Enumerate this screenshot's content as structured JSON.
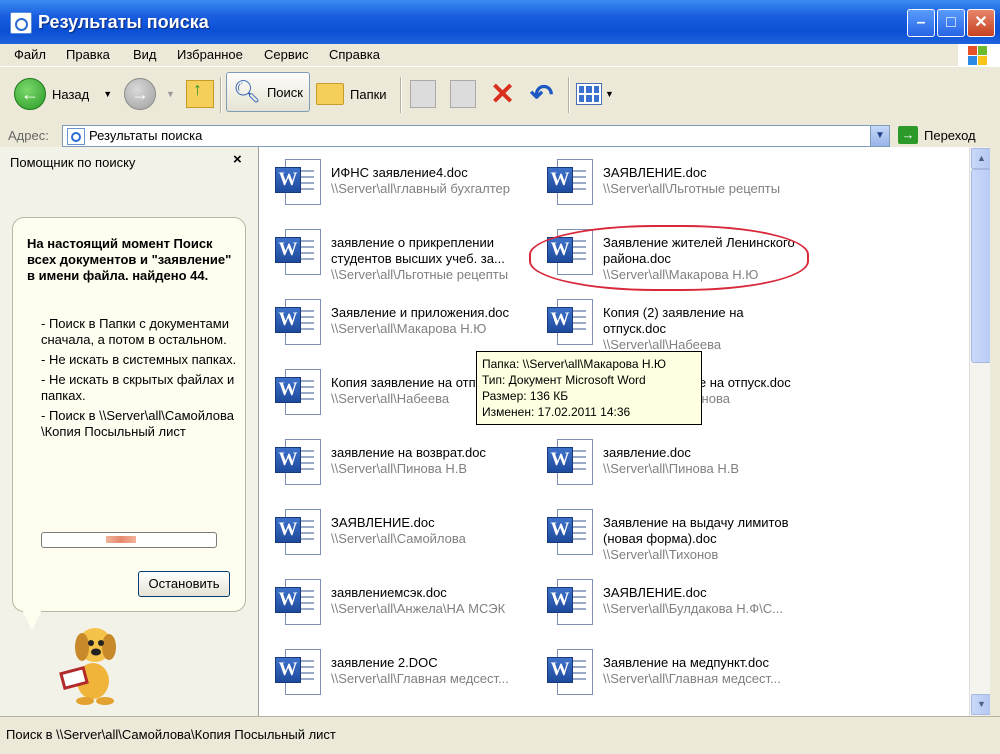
{
  "window": {
    "title": "Результаты поиска"
  },
  "menu": [
    "Файл",
    "Правка",
    "Вид",
    "Избранное",
    "Сервис",
    "Справка"
  ],
  "toolbar": {
    "back_label": "Назад",
    "search_label": "Поиск",
    "folders_label": "Папки"
  },
  "address": {
    "label": "Адрес:",
    "value": "Результаты поиска",
    "go_label": "Переход"
  },
  "sidebar": {
    "title": "Помощник по поиску",
    "close": "×",
    "heading": "На настоящий момент Поиск всех документов и \"заявление\" в имени файла. найдено 44.",
    "notes": [
      "- Поиск в Папки с документами сначала, а потом в остальном.",
      "- Не искать в системных папках.",
      "- Не искать в скрытых файлах и папках.",
      "- Поиск в \\\\Server\\all\\Самойлова\\Копия Посыльный лист"
    ],
    "stop_label": "Остановить"
  },
  "results": [
    {
      "name": "ИФНС заявление4.doc",
      "path": "\\\\Server\\all\\главный бухгалтер"
    },
    {
      "name": "ЗАЯВЛЕНИЕ.doc",
      "path": "\\\\Server\\all\\Льготные рецепты"
    },
    {
      "name": "заявление о прикреплении студентов высших учеб. за...",
      "path": "\\\\Server\\all\\Льготные рецепты"
    },
    {
      "name": "Заявление жителей Ленинского района.doc",
      "path": "\\\\Server\\all\\Макарова Н.Ю"
    },
    {
      "name": "Заявление и приложения.doc",
      "path": "\\\\Server\\all\\Макарова Н.Ю"
    },
    {
      "name": "Копия (2) заявление на отпуск.doc",
      "path": "\\\\Server\\all\\Набеева"
    },
    {
      "name": "Копия заявление на отпуск.doc",
      "path": "\\\\Server\\all\\Набеева"
    },
    {
      "name": "Копия заявление на отпуск.doc",
      "path": "\\\\Server\\all\\Симонова"
    },
    {
      "name": "заявление на возврат.doc",
      "path": "\\\\Server\\all\\Пинова Н.В"
    },
    {
      "name": "заявление.doc",
      "path": "\\\\Server\\all\\Пинова Н.В"
    },
    {
      "name": "ЗАЯВЛЕНИЕ.doc",
      "path": "\\\\Server\\all\\Самойлова"
    },
    {
      "name": "Заявление на выдачу лимитов (новая форма).doc",
      "path": "\\\\Server\\all\\Тихонов"
    },
    {
      "name": "заявлениемсэк.doc",
      "path": "\\\\Server\\all\\Анжела\\НА МСЭК"
    },
    {
      "name": "ЗАЯВЛЕНИЕ.doc",
      "path": "\\\\Server\\all\\Булдакова Н.Ф\\С..."
    },
    {
      "name": "заявление 2.DOC",
      "path": "\\\\Server\\all\\Главная медсест..."
    },
    {
      "name": "Заявление на медпункт.doc",
      "path": "\\\\Server\\all\\Главная медсест..."
    }
  ],
  "tooltip": [
    "Папка: \\\\Server\\all\\Макарова Н.Ю",
    "Тип: Документ Microsoft Word",
    "Размер: 136 КБ",
    "Изменен: 17.02.2011 14:36"
  ],
  "status": {
    "text": "Поиск в \\\\Server\\all\\Самойлова\\Копия Посыльный лист"
  }
}
